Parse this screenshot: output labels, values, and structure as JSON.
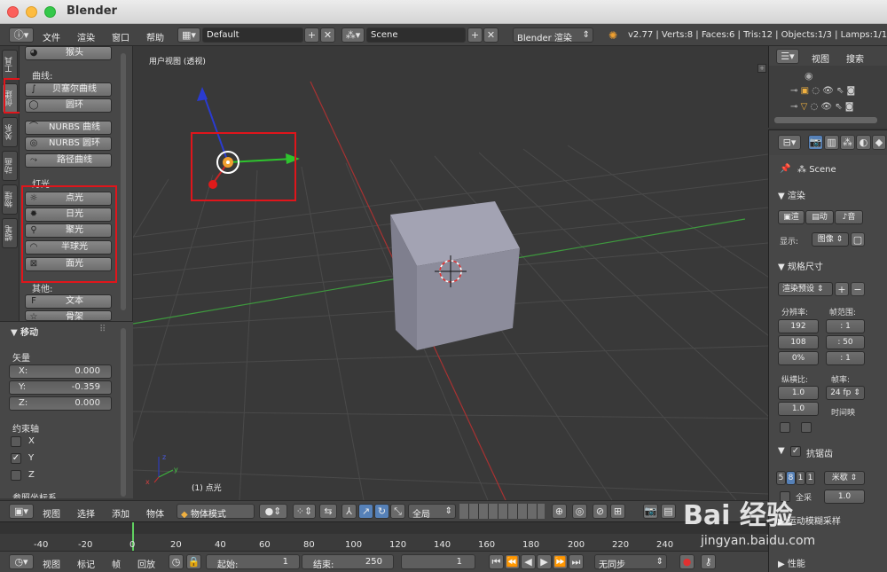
{
  "window": {
    "title": "Blender"
  },
  "infobar": {
    "menus": [
      "文件",
      "渲染",
      "窗口",
      "帮助"
    ],
    "layout": "Default",
    "scene": "Scene",
    "engine": "Blender 渲染",
    "stats": "v2.77 | Verts:8 | Faces:6 | Tris:12 | Objects:1/3 | Lamps:1/1 | P"
  },
  "lefttabs": [
    "工具",
    "创建",
    "关系",
    "动画",
    "物理",
    "蜡笔"
  ],
  "toolshelf": {
    "top_item": "猴头",
    "curves_label": "曲线:",
    "curves": [
      "贝塞尔曲线",
      "圆环"
    ],
    "nurbs": [
      "NURBS 曲线",
      "NURBS 圆环",
      "路径曲线"
    ],
    "lamps_label": "灯光",
    "lamps": [
      "点光",
      "日光",
      "聚光",
      "半球光",
      "面光"
    ],
    "other_label": "其他:",
    "other": [
      "文本",
      "骨架"
    ]
  },
  "operator": {
    "title": "▼ 移动",
    "vector_label": "矢量",
    "x_label": "X:",
    "x": "0.000",
    "y_label": "Y:",
    "y": "-0.359",
    "z_label": "Z:",
    "z": "0.000",
    "constraint_label": "约束轴",
    "axes": [
      "X",
      "Y",
      "Z"
    ],
    "orient_label": "参照坐标系"
  },
  "viewport": {
    "view_label": "用户视图 (透视)",
    "object_label": "(1) 点光"
  },
  "hdr3d": {
    "menus": [
      "视图",
      "选择",
      "添加",
      "物体"
    ],
    "mode": "物体模式",
    "layers": "全局"
  },
  "timeline": {
    "ticks": [
      "-40",
      "-20",
      "0",
      "20",
      "40",
      "60",
      "80",
      "100",
      "120",
      "140",
      "160",
      "180",
      "200",
      "220",
      "240"
    ]
  },
  "tlhdr": {
    "menus": [
      "视图",
      "标记",
      "帧",
      "回放"
    ],
    "start_label": "起始:",
    "start": "1",
    "end_label": "结束:",
    "end": "250",
    "current": "1",
    "sync": "无同步"
  },
  "outliner": {
    "view": "视图",
    "search": "搜索"
  },
  "props": {
    "scene": "Scene",
    "render_title": "▼ 渲染",
    "render_btns": [
      "渲",
      "动",
      "音"
    ],
    "display_label": "显示:",
    "display": "图像",
    "dims_title": "▼ 规格尺寸",
    "preset": "渲染预设",
    "res_label": "分辨率:",
    "res_x": "192",
    "res_y": "108",
    "res_pct": "0%",
    "range_label": "帧范围:",
    "fs": ": 1",
    "fe": ": 50",
    "fstep": ": 1",
    "aspect_label": "纵横比:",
    "ax": "1.0",
    "ay": "1.0",
    "rate_label": "帧率:",
    "rate": "24 fp",
    "remap_label": "时间映",
    "aa_title": "抗锯齿",
    "aa_samples": [
      "5",
      "8",
      "1",
      "1"
    ],
    "filter": "米歇",
    "full_label": "全采",
    "full_value": "1.0",
    "motion_label": "▶ 运动模糊采样",
    "perf_label": "▶ 性能"
  },
  "watermark": {
    "brand": "Bai 经验",
    "url": "jingyan.baidu.com"
  }
}
